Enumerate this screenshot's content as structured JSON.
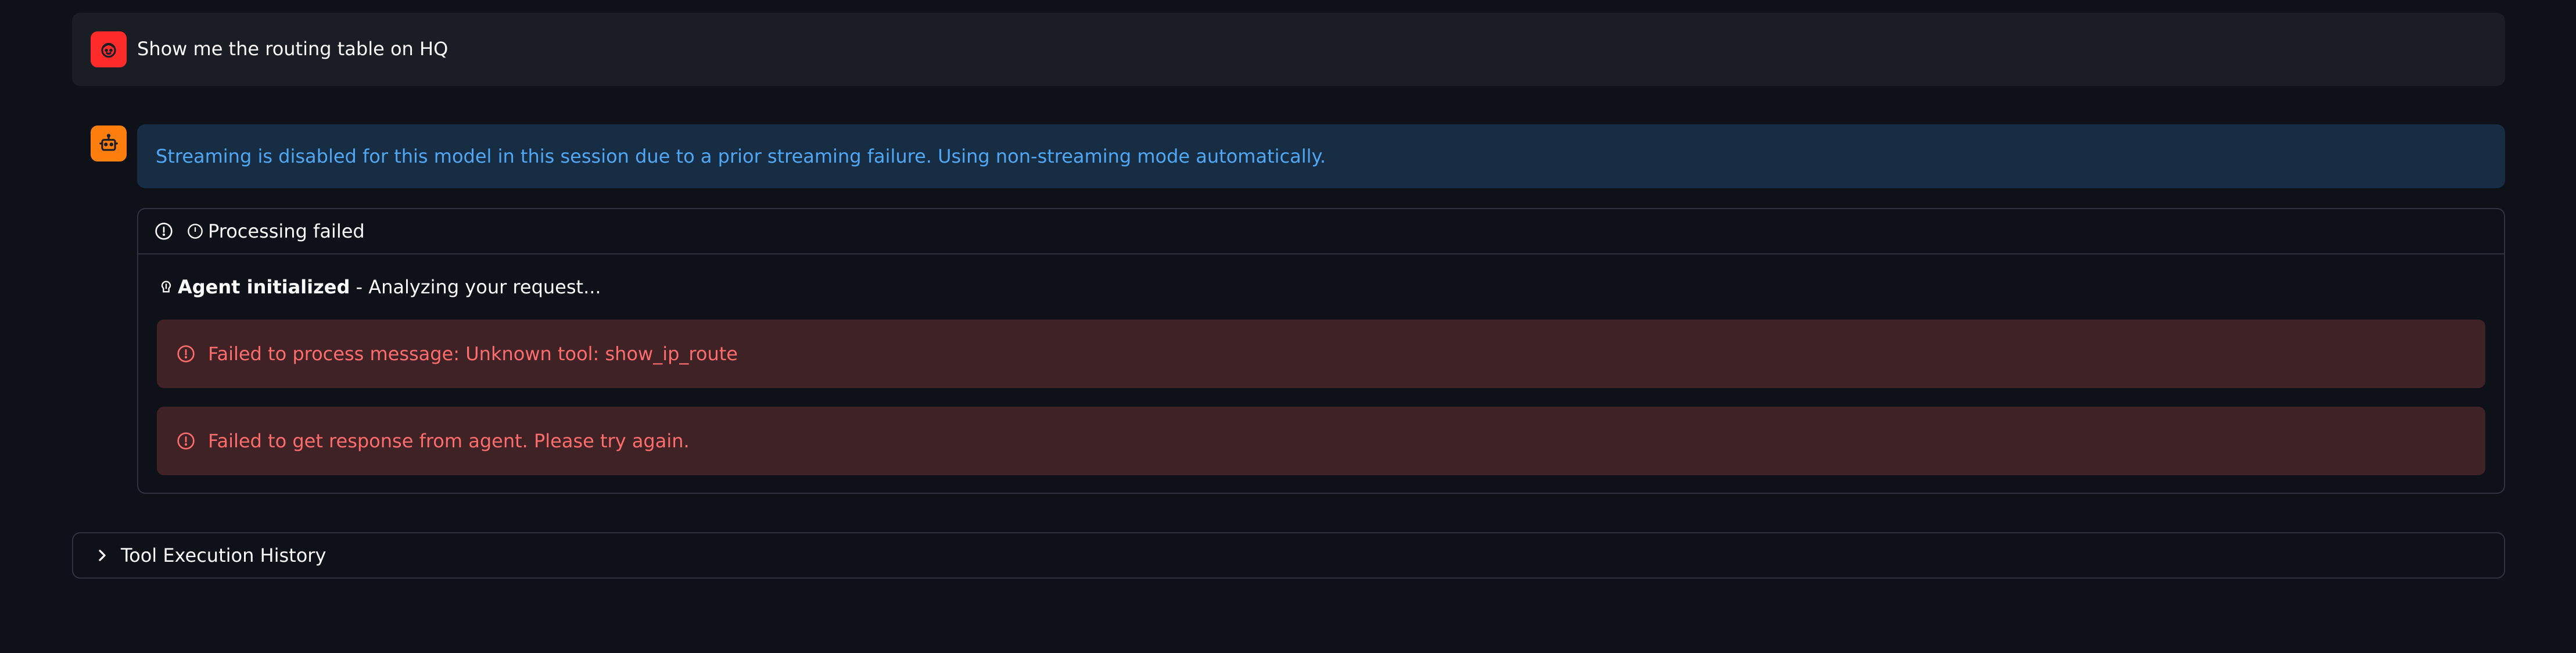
{
  "user_message": {
    "avatar_icon": "user-face-icon",
    "avatar_color": "#ff2b2b",
    "text": "Show me the routing table on HQ"
  },
  "assistant": {
    "avatar_icon": "robot-icon",
    "avatar_color": "#ff7f0e",
    "info_banner": "Streaming is disabled for this model in this session due to a prior streaming failure. Using non-streaming mode automatically.",
    "status": {
      "label": "Processing failed",
      "icons": [
        "alert-circle-icon",
        "clock-icon"
      ]
    },
    "agent_line": {
      "icon": "brain-icon",
      "bold": "Agent initialized",
      "rest": " - Analyzing your request..."
    },
    "errors": [
      "Failed to process message: Unknown tool: show_ip_route",
      "Failed to get response from agent. Please try again."
    ]
  },
  "history": {
    "label": "Tool Execution History",
    "icon": "chevron-right-icon"
  },
  "colors": {
    "background": "#0e1117",
    "info_text": "#4fa8f5",
    "info_bg": "#172d43",
    "error_text": "#ff6c6c",
    "error_bg": "#3e2226"
  }
}
